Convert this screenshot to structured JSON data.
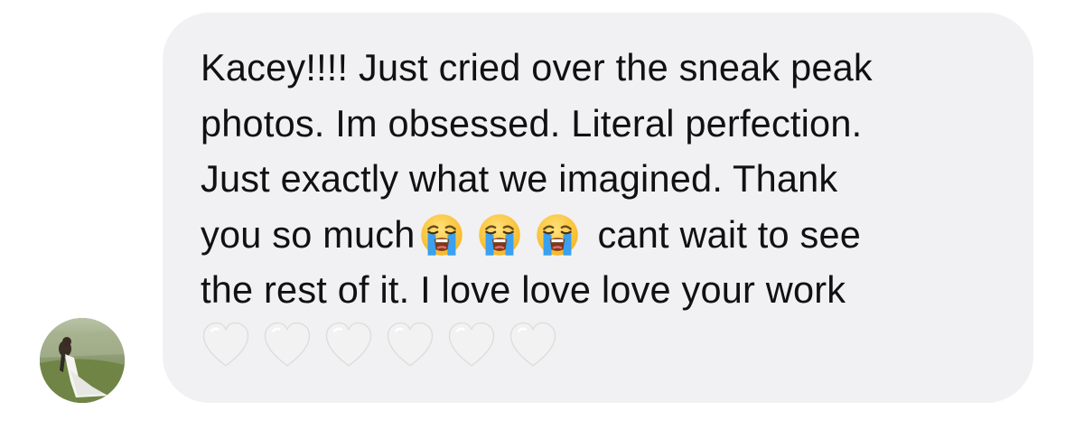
{
  "message": {
    "lines": [
      "Kacey!!!! Just cried over the sneak peak",
      "photos. Im obsessed. Literal perfection.",
      "Just exactly what we imagined. Thank",
      "you so much",
      "cant wait to see",
      "the rest of it. I love love love your work"
    ],
    "inline_emojis": [
      "loudly-crying-face",
      "loudly-crying-face",
      "loudly-crying-face"
    ],
    "trailing_emojis": [
      "white-heart",
      "white-heart",
      "white-heart",
      "white-heart",
      "white-heart",
      "white-heart"
    ]
  },
  "sender": {
    "avatar_icon": "bride-photo-avatar"
  },
  "colors": {
    "bubble_background": "#f1f1f3",
    "text": "#111111"
  }
}
